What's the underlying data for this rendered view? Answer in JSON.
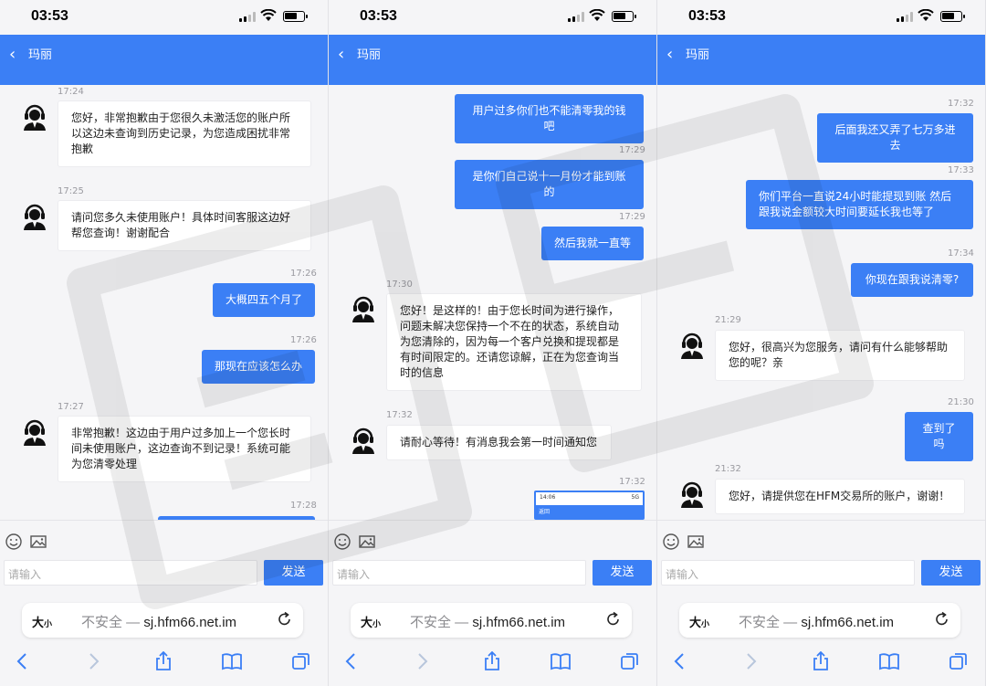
{
  "accent_color": "#3b7ff5",
  "screens": [
    {
      "status_time": "03:53",
      "contact_name": "玛丽",
      "messages": [
        {
          "time": "17:24",
          "side": "in",
          "text": "您好，非常抱歉由于您很久未激活您的账户所以这边未查询到历史记录，为您造成困扰非常抱歉"
        },
        {
          "time": "17:25",
          "side": "in",
          "text": "请问您多久未使用账户！具体时间客服这边好帮您查询！谢谢配合"
        },
        {
          "time": "17:26",
          "side": "out",
          "text": "大概四五个月了"
        },
        {
          "time": "17:26",
          "side": "out",
          "text": "那现在应该怎么办"
        },
        {
          "time": "17:27",
          "side": "in",
          "text": "非常抱歉！这边由于用户过多加上一个您长时间未使用账户，这边查询不到记录！系统可能为您清零处理"
        },
        {
          "time": "17:28",
          "side": "out",
          "text": ""
        }
      ],
      "input_placeholder": "请输入",
      "send_label": "发送",
      "aa_label": "大",
      "aa_small": "小",
      "url_insecure": "不安全 —",
      "url": "sj.hfm66.net.im"
    },
    {
      "status_time": "03:53",
      "contact_name": "玛丽",
      "messages": [
        {
          "time": "17:29",
          "side": "out",
          "text": "用户过多你们也不能清零我的钱吧"
        },
        {
          "time": "17:29",
          "side": "out",
          "text": "是你们自己说十一月份才能到账的"
        },
        {
          "time": "17:29",
          "side": "out",
          "text": "然后我就一直等"
        },
        {
          "time": "17:30",
          "side": "in",
          "text": "您好！是这样的！由于您长时间为进行操作，问题未解决您保持一个不在的状态，系统自动为您清除的，因为每一个客户兑换和提现都是有时间限定的。还请您谅解，正在为您查询当时的信息"
        },
        {
          "time": "17:32",
          "side": "in",
          "text": "请耐心等待！有消息我会第一时间通知您"
        },
        {
          "time": "17:32",
          "side": "out",
          "text": ""
        }
      ],
      "screenshot_thumb": {
        "time": "14:06",
        "status": "5G",
        "back": "返回"
      },
      "input_placeholder": "请输入",
      "send_label": "发送",
      "aa_label": "大",
      "aa_small": "小",
      "url_insecure": "不安全 —",
      "url": "sj.hfm66.net.im"
    },
    {
      "status_time": "03:53",
      "contact_name": "玛丽",
      "messages": [
        {
          "time": "17:32",
          "side": "out",
          "text": "后面我还又弄了七万多进去"
        },
        {
          "time": "17:33",
          "side": "out",
          "text": "你们平台一直说24小时能提现到账 然后跟我说金额较大时间要延长我也等了"
        },
        {
          "time": "17:34",
          "side": "out",
          "text": "你现在跟我说清零?"
        },
        {
          "time": "21:29",
          "side": "in",
          "text": "您好，很高兴为您服务，请问有什么能够帮助您的呢？亲"
        },
        {
          "time": "21:30",
          "side": "out",
          "text": "查到了吗"
        },
        {
          "time": "21:32",
          "side": "in",
          "text": "您好，请提供您在HFM交易所的账户，谢谢！"
        }
      ],
      "input_placeholder": "请输入",
      "send_label": "发送",
      "aa_label": "大",
      "aa_small": "小",
      "url_insecure": "不安全 —",
      "url": "sj.hfm66.net.im"
    }
  ]
}
